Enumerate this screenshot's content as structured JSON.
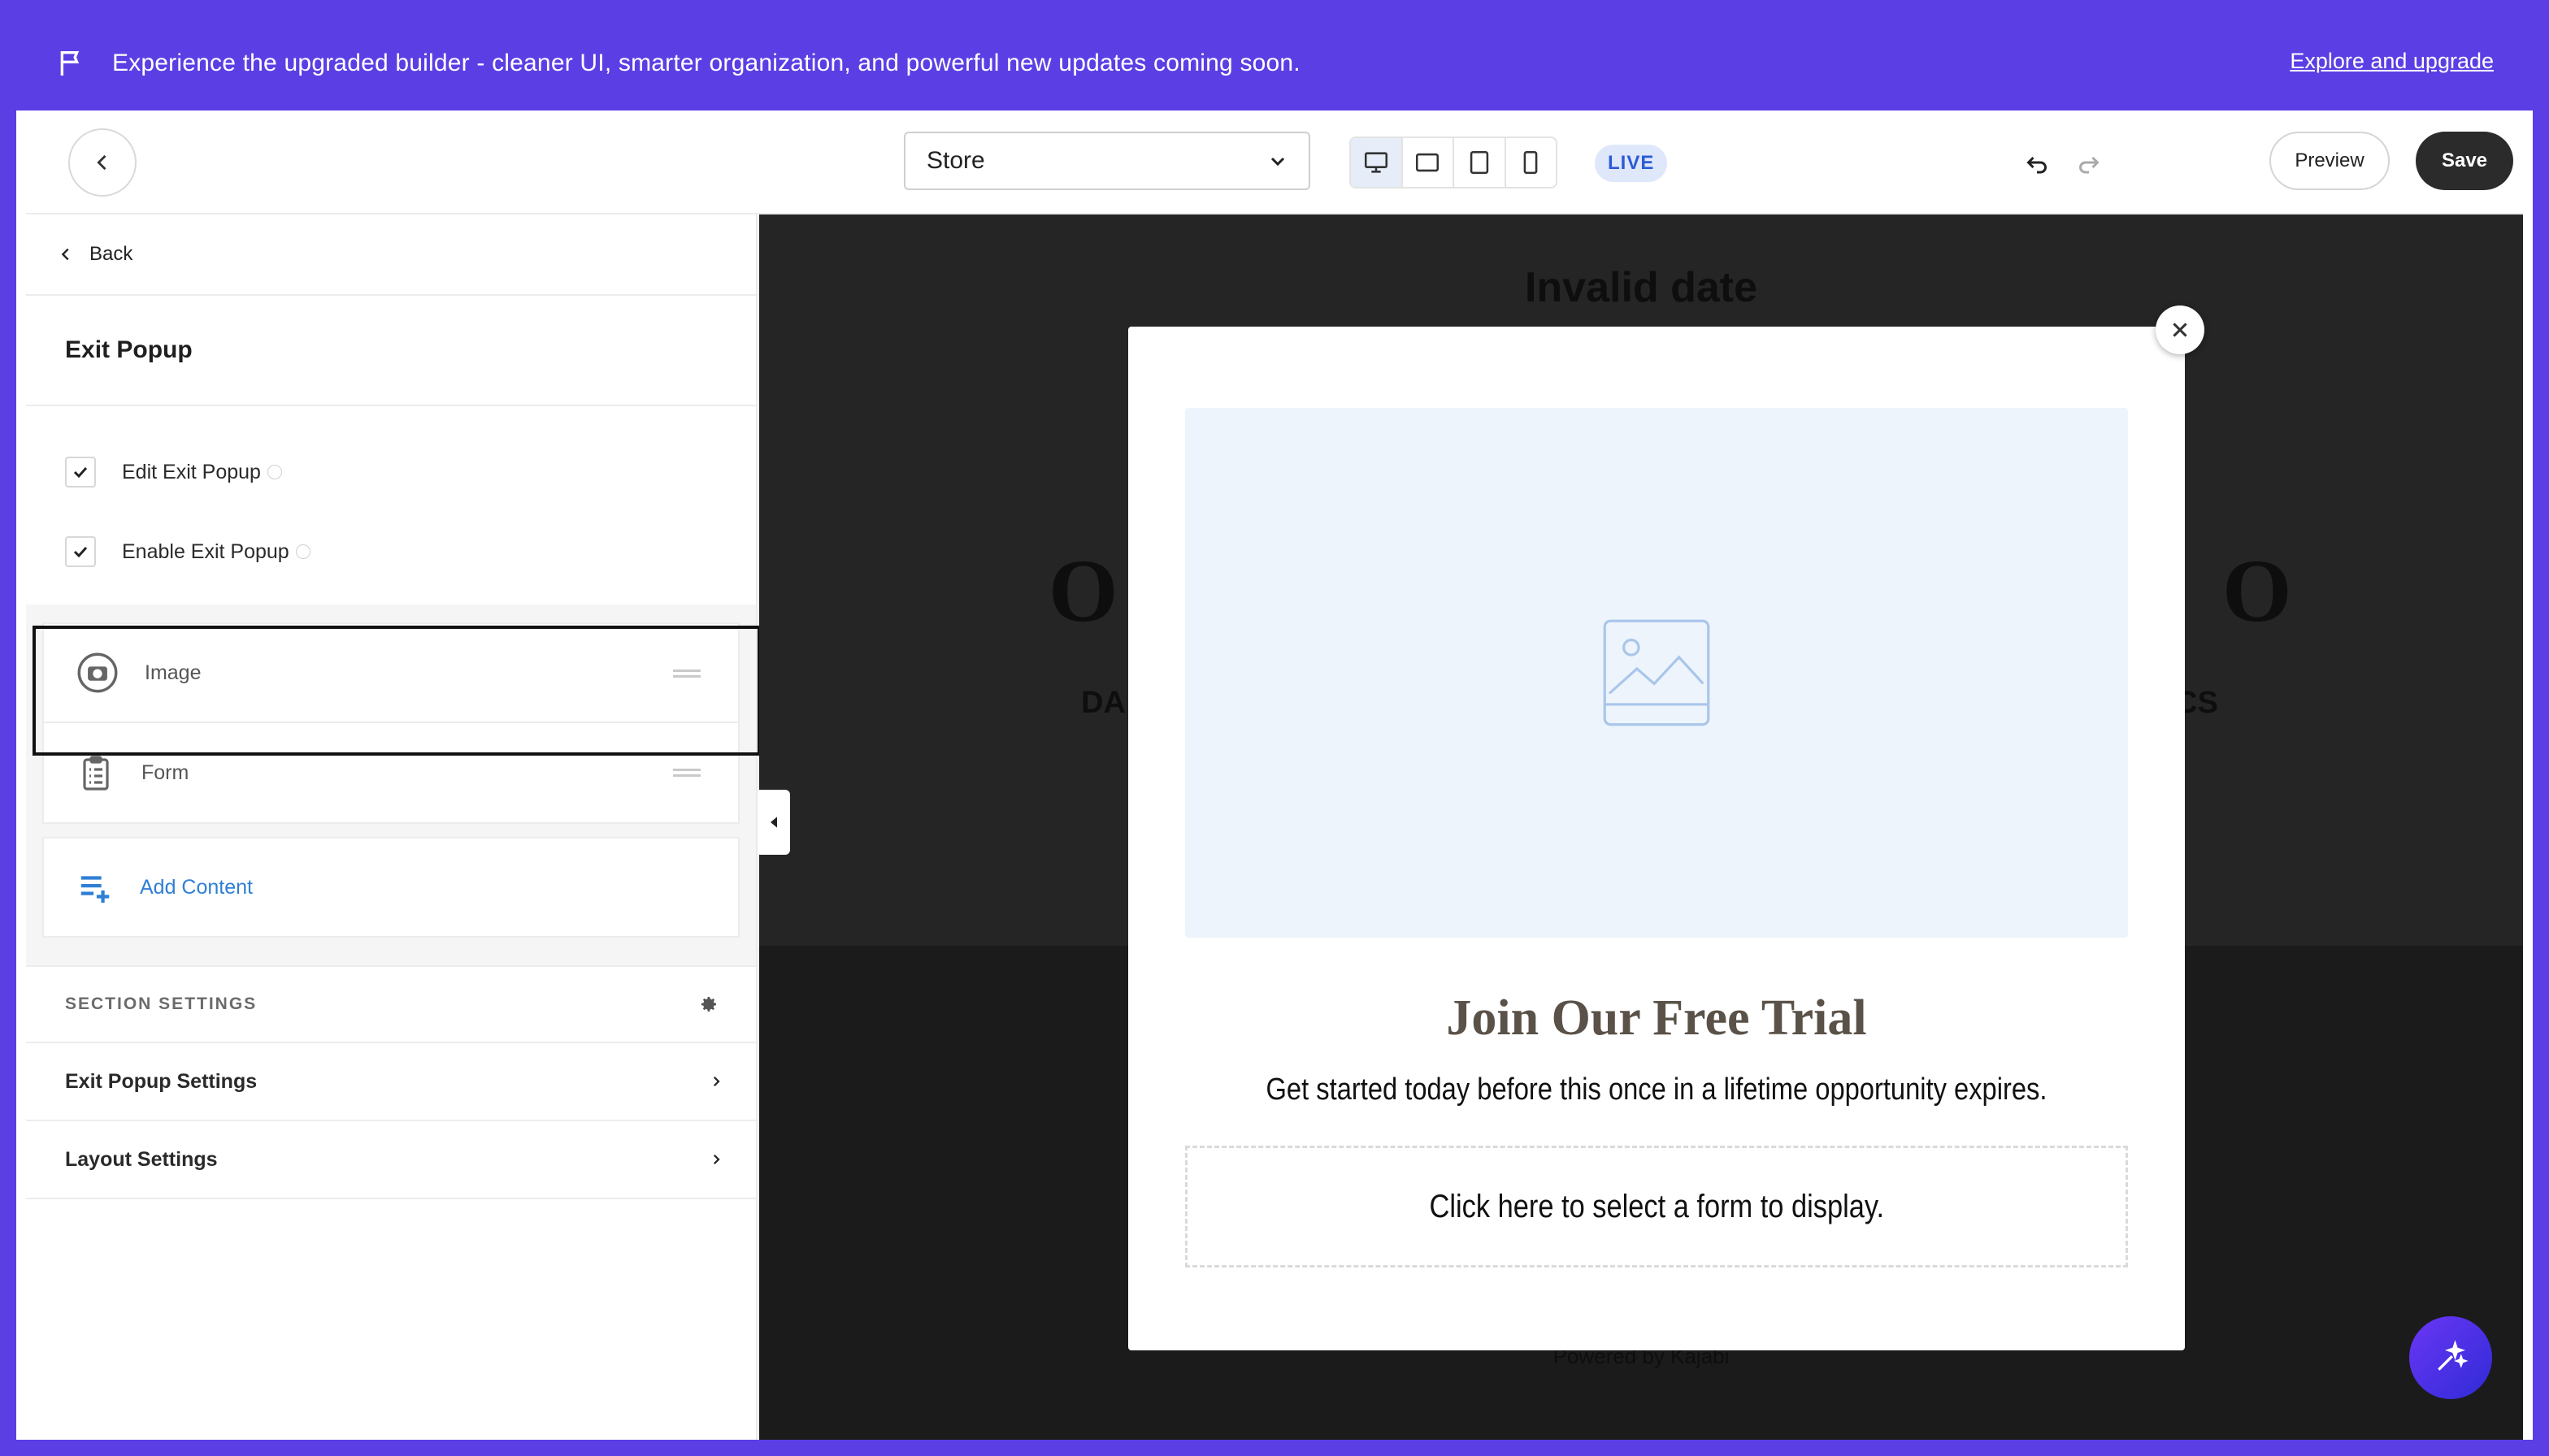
{
  "banner": {
    "message": "Experience the upgraded builder - cleaner UI, smarter organization, and powerful new updates coming soon.",
    "link": "Explore and upgrade",
    "icon": "flag-icon"
  },
  "toolbar": {
    "page_select": "Store",
    "devices": [
      "desktop-icon",
      "tablet-landscape-icon",
      "tablet-portrait-icon",
      "mobile-icon"
    ],
    "live_badge": "LIVE",
    "preview_label": "Preview",
    "save_label": "Save"
  },
  "panel": {
    "back_label": "Back",
    "title": "Exit Popup",
    "checks": [
      {
        "label": "Edit Exit Popup",
        "checked": true
      },
      {
        "label": "Enable Exit Popup",
        "checked": true
      }
    ],
    "blocks": [
      {
        "label": "Image",
        "icon": "camera-icon"
      },
      {
        "label": "Form",
        "icon": "clipboard-icon"
      }
    ],
    "add_content": "Add Content",
    "section_settings": "SECTION SETTINGS",
    "nav": [
      "Exit Popup Settings",
      "Layout Settings"
    ]
  },
  "canvas": {
    "date_text": "Invalid date",
    "powered": "Powered by Kajabi",
    "bg_left_letter": "O",
    "bg_right_letter": "O",
    "bg_left_text": "DA",
    "bg_right_text": "CS"
  },
  "modal": {
    "heading": "Join Our Free Trial",
    "subheading": "Get started today before this once in a lifetime opportunity expires.",
    "form_placeholder": "Click here to select a form to display."
  },
  "colors": {
    "brand": "#5b3fe4",
    "link_blue": "#2f7fd4",
    "heading_brown": "#5a5148"
  }
}
